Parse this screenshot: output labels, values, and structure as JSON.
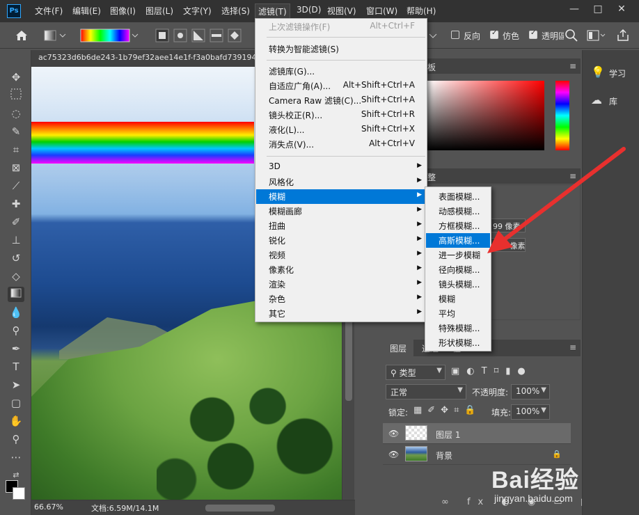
{
  "menubar": {
    "logo": "Ps",
    "items": [
      "文件(F)",
      "编辑(E)",
      "图像(I)",
      "图层(L)",
      "文字(Y)",
      "选择(S)",
      "滤镜(T)",
      "3D(D)",
      "视图(V)",
      "窗口(W)",
      "帮助(H)"
    ],
    "window_controls": [
      "—",
      "□",
      "✕"
    ]
  },
  "options": {
    "reverse_label": "反向",
    "dither_label": "仿色",
    "transparency_label": "透明區"
  },
  "document": {
    "tab_title": "ac75323d6b6de243-1b79ef32aee14e1f-f3a0bafd739194",
    "zoom": "66.67%",
    "doc_info": "文档:6.59M/14.1M"
  },
  "filter_menu": {
    "items": [
      {
        "label": "上次滤镜操作(F)",
        "shortcut": "Alt+Ctrl+F",
        "disabled": true
      },
      {
        "label": "转换为智能滤镜(S)",
        "shortcut": ""
      },
      {
        "label": "滤镜库(G)...",
        "shortcut": ""
      },
      {
        "label": "自适应广角(A)...",
        "shortcut": "Alt+Shift+Ctrl+A"
      },
      {
        "label": "Camera Raw 滤镜(C)...",
        "shortcut": "Shift+Ctrl+A"
      },
      {
        "label": "镜头校正(R)...",
        "shortcut": "Shift+Ctrl+R"
      },
      {
        "label": "液化(L)...",
        "shortcut": "Shift+Ctrl+X"
      },
      {
        "label": "消失点(V)...",
        "shortcut": "Alt+Ctrl+V"
      },
      {
        "label": "3D",
        "submenu": true
      },
      {
        "label": "风格化",
        "submenu": true
      },
      {
        "label": "模糊",
        "submenu": true,
        "highlighted": true
      },
      {
        "label": "模糊画廊",
        "submenu": true
      },
      {
        "label": "扭曲",
        "submenu": true
      },
      {
        "label": "锐化",
        "submenu": true
      },
      {
        "label": "视频",
        "submenu": true
      },
      {
        "label": "像素化",
        "submenu": true
      },
      {
        "label": "渲染",
        "submenu": true
      },
      {
        "label": "杂色",
        "submenu": true
      },
      {
        "label": "其它",
        "submenu": true
      }
    ]
  },
  "blur_menu": {
    "items": [
      "表面模糊...",
      "动感模糊...",
      "方框模糊...",
      "高斯模糊...",
      "进一步模糊",
      "径向模糊...",
      "镜头模糊...",
      "模糊",
      "平均",
      "特殊模糊...",
      "形状模糊..."
    ],
    "highlighted_index": 3
  },
  "right_strip": {
    "learn": "学习",
    "libraries": "库"
  },
  "panels": {
    "color_tab_partial": "板",
    "adjust_tab_partial": "整",
    "field1": "99 像素",
    "field2": "112 像素"
  },
  "layers": {
    "tab_layers": "图层",
    "tab_channels": "通道",
    "tab_paths_partial": "径",
    "filter_type": "类型",
    "blend_mode": "正常",
    "opacity_label": "不透明度:",
    "opacity_value": "100%",
    "lock_label": "锁定:",
    "fill_label": "填充:",
    "fill_value": "100%",
    "rows": [
      {
        "name": "图层 1",
        "selected": true
      },
      {
        "name": "背景",
        "selected": false
      }
    ],
    "footer_icons": "∞ fx ◐ ◉ ▭ ▣ 🗑"
  },
  "watermark": {
    "brand": "Bai经验",
    "url": "jingyan.baidu.com"
  },
  "colors": {
    "highlight": "#0078d7",
    "annotation_arrow": "#e8302e"
  }
}
